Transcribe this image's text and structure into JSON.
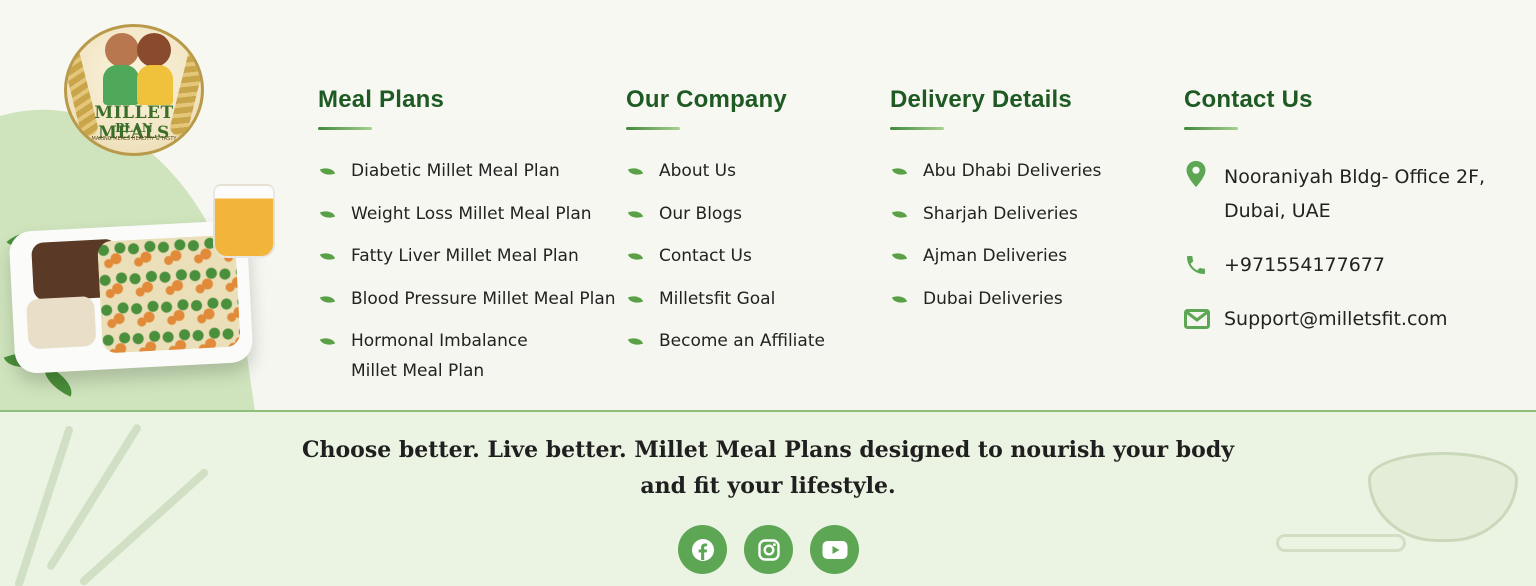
{
  "logo": {
    "line1": "MILLET MEALS",
    "line2": "PLAN",
    "tagline": "MAKING MEALS HEALTHY & TASTY"
  },
  "meal_plans": {
    "title": "Meal Plans",
    "items": [
      "Diabetic Millet Meal Plan",
      "Weight Loss Millet Meal Plan",
      "Fatty Liver Millet Meal Plan",
      "Blood Pressure Millet Meal Plan",
      "Hormonal Imbalance Millet Meal Plan"
    ]
  },
  "company": {
    "title": "Our Company",
    "items": [
      "About Us",
      "Our Blogs",
      "Contact Us",
      "Milletsfit Goal",
      "Become an Affiliate"
    ]
  },
  "delivery": {
    "title": "Delivery Details",
    "items": [
      "Abu Dhabi Deliveries",
      "Sharjah Deliveries",
      "Ajman Deliveries",
      "Dubai Deliveries"
    ]
  },
  "contact": {
    "title": "Contact Us",
    "address": "Nooraniyah Bldg- Office 2F, Dubai, UAE",
    "phone": "+971554177677",
    "email": "Support@milletsfit.com"
  },
  "footer": {
    "tagline_line1": "Choose better. Live better. Millet Meal Plans designed to nourish your body",
    "tagline_line2": "and fit your lifestyle.",
    "socials": [
      "facebook-icon",
      "instagram-icon",
      "youtube-icon"
    ]
  },
  "colors": {
    "heading": "#1f5a24",
    "accent": "#5da654",
    "background": "#f7f8f1",
    "footer_bg": "#ebf3e3"
  }
}
